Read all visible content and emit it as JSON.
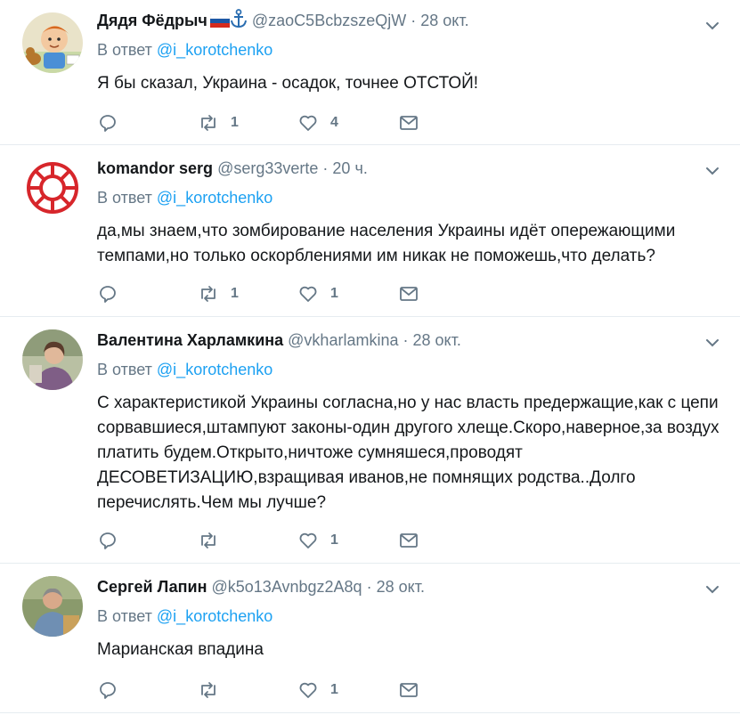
{
  "colors": {
    "text": "#14171a",
    "muted": "#657786",
    "link": "#1da1f2",
    "divider": "#e6ecf0",
    "icon": "#657786"
  },
  "tweets": [
    {
      "name": "Дядя Фёдрыч",
      "handle": "@zaoC5BcbzszeQjW",
      "dot": "·",
      "time": "28 окт.",
      "reply_prefix": "В ответ",
      "reply_handle": "@i_korotchenko",
      "text": "Я бы сказал, Украина - осадок, точнее ОТСТОЙ!",
      "retweets": "1",
      "likes": "4",
      "icons": {
        "flag": "russia-flag-icon",
        "badge": "anchor-icon"
      }
    },
    {
      "name": "komandor serg",
      "handle": "@serg33verte",
      "dot": "·",
      "time": "20 ч.",
      "reply_prefix": "В ответ",
      "reply_handle": "@i_korotchenko",
      "text": "да,мы знаем,что зомбирование населения Украины идёт опережающими темпами,но только оскорблениями им никак не поможешь,что делать?",
      "retweets": "1",
      "likes": "1"
    },
    {
      "name": "Валентина Харламкина",
      "handle": "@vkharlamkina",
      "dot": "·",
      "time": "28 окт.",
      "reply_prefix": "В ответ",
      "reply_handle": "@i_korotchenko",
      "text": "С характеристикой Украины согласна,но у нас власть предержащие,как с цепи сорвавшиеся,штампуют законы-один другого хлеще.Скоро,наверное,за воздух платить будем.Открыто,ничтоже сумняшеся,проводят ДЕСОВЕТИЗАЦИЮ,взращивая иванов,не помнящих родства..Долго перечислять.Чем мы лучше?",
      "retweets": "",
      "likes": "1"
    },
    {
      "name": "Сергей Лапин",
      "handle": "@k5o13Avnbgz2A8q",
      "dot": "·",
      "time": "28 окт.",
      "reply_prefix": "В ответ",
      "reply_handle": "@i_korotchenko",
      "text": "Марианская впадина",
      "retweets": "",
      "likes": "1"
    }
  ]
}
